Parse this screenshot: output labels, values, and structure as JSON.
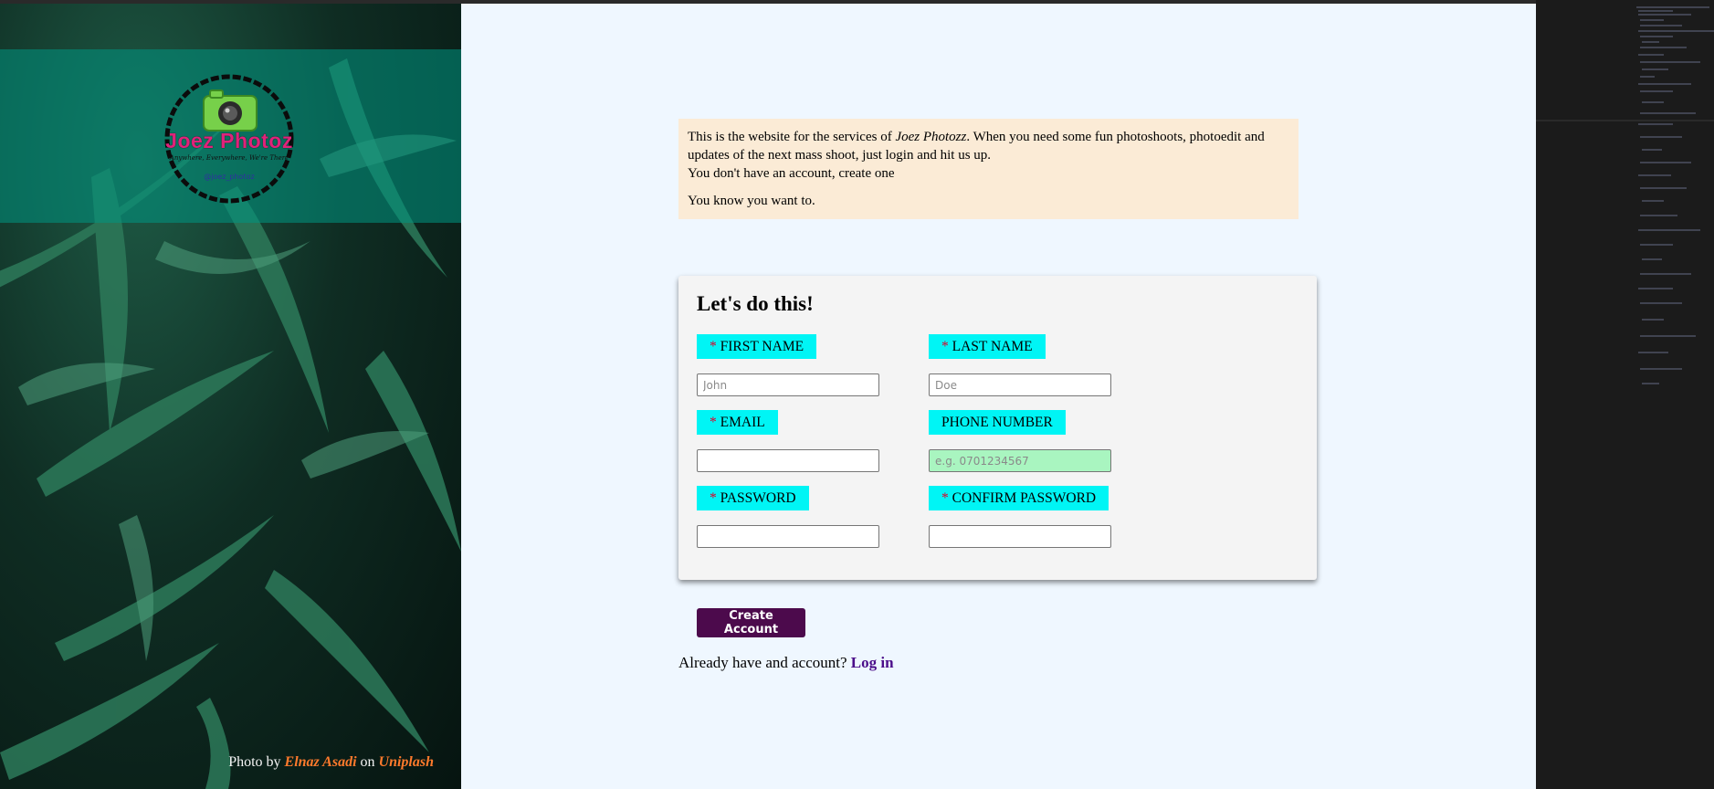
{
  "left_panel": {
    "logo": {
      "title": "Joez Photoz",
      "tagline": "Anywhere, Everywhere, We're There",
      "handle": "@joez_photoz"
    },
    "credit": {
      "prefix": "Photo by",
      "author": "Elnaz Asadi",
      "middle": "on",
      "source": "Uniplash"
    }
  },
  "intro": {
    "text_before": "This is the website for the services of ",
    "brand": "Joez Photozz",
    "text_after": ". When you need some fun photoshoots, photoedit and updates of the next mass shoot, just login and hit us up.",
    "line2": "You don't have an account, create one",
    "line3": "You know you want to."
  },
  "form": {
    "heading": "Let's do this!",
    "required_mark": "*",
    "first_name": {
      "label": "FIRST NAME",
      "placeholder": "John",
      "value": ""
    },
    "last_name": {
      "label": "LAST NAME",
      "placeholder": "Doe",
      "value": ""
    },
    "email": {
      "label": "EMAIL",
      "placeholder": "",
      "value": ""
    },
    "phone": {
      "label": "PHONE NUMBER",
      "placeholder": "e.g. 0701234567",
      "value": ""
    },
    "password": {
      "label": "PASSWORD",
      "placeholder": "",
      "value": ""
    },
    "confirm_password": {
      "label": "CONFIRM PASSWORD",
      "placeholder": "",
      "value": ""
    },
    "submit_label": "Create Account"
  },
  "footer": {
    "text": "Already have and account?",
    "login_link": "Log in"
  },
  "colors": {
    "label_bg": "#00f5f5",
    "button_bg": "#4c0a4c",
    "info_bg": "#fbebd6",
    "page_bg": "#eff7ff",
    "link": "#4b0e8a"
  }
}
